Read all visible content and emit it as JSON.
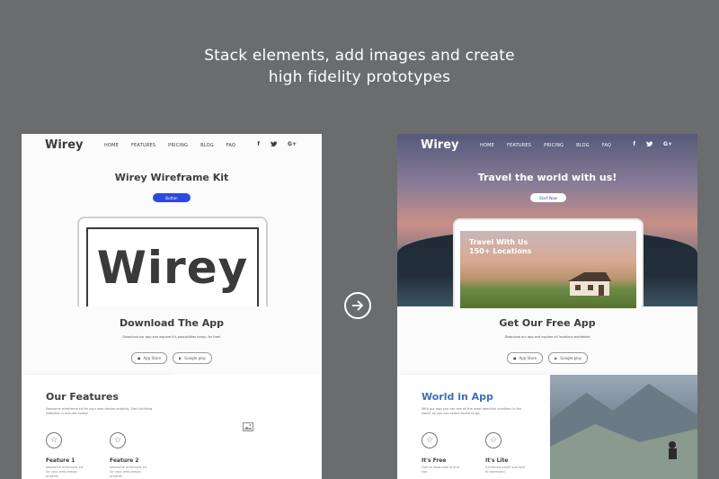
{
  "headline": {
    "line1": "Stack elements, add images and create",
    "line2": "high fidelity prototypes"
  },
  "colors": {
    "background": "#6b6c6e",
    "accent_blue": "#2d48e0",
    "feature_blue": "#3f6fb5"
  },
  "nav": {
    "logo": "Wirey",
    "links": [
      "HOME",
      "FEATURES",
      "PRICING",
      "BLOG",
      "FAQ"
    ],
    "socials": [
      "f",
      "t",
      "G+"
    ]
  },
  "left": {
    "hero_title": "Wirey Wireframe Kit",
    "hero_button": "Button",
    "device_text": "Wirey",
    "download_title": "Download The App",
    "download_sub": "Download our app and explore it's possibilities today, for free!",
    "store_apple": "App Store",
    "store_google": "Google play",
    "features_title": "Our Features",
    "features_desc": "Awesome wireframe kit for your web design projects. Start building websites in minutes today!",
    "feature1_name": "Feature 1",
    "feature1_text": "Awesome wireframe kit for your web design projects",
    "feature2_name": "Feature 2",
    "feature2_text": "Awesome wireframe kit for your web design projects",
    "placeholder_icon": "image-placeholder-icon"
  },
  "right": {
    "hero_title": "Travel the world with us!",
    "hero_button": "Start Now",
    "photo_line1": "Travel With Us",
    "photo_line2": "150+ Locations",
    "download_title": "Get Our Free App",
    "download_sub": "Download our app and explore all locations worldwide",
    "store_apple": "App Store",
    "store_google": "Google play",
    "features_title": "World in App",
    "features_desc": "With our app you can see all the most beautiful locations in the world, so you can select where to go.",
    "feature1_name": "It's Free",
    "feature1_text": "Free to download and to use",
    "feature2_name": "It's Lite",
    "feature2_text": "Extremely small size app to download"
  }
}
